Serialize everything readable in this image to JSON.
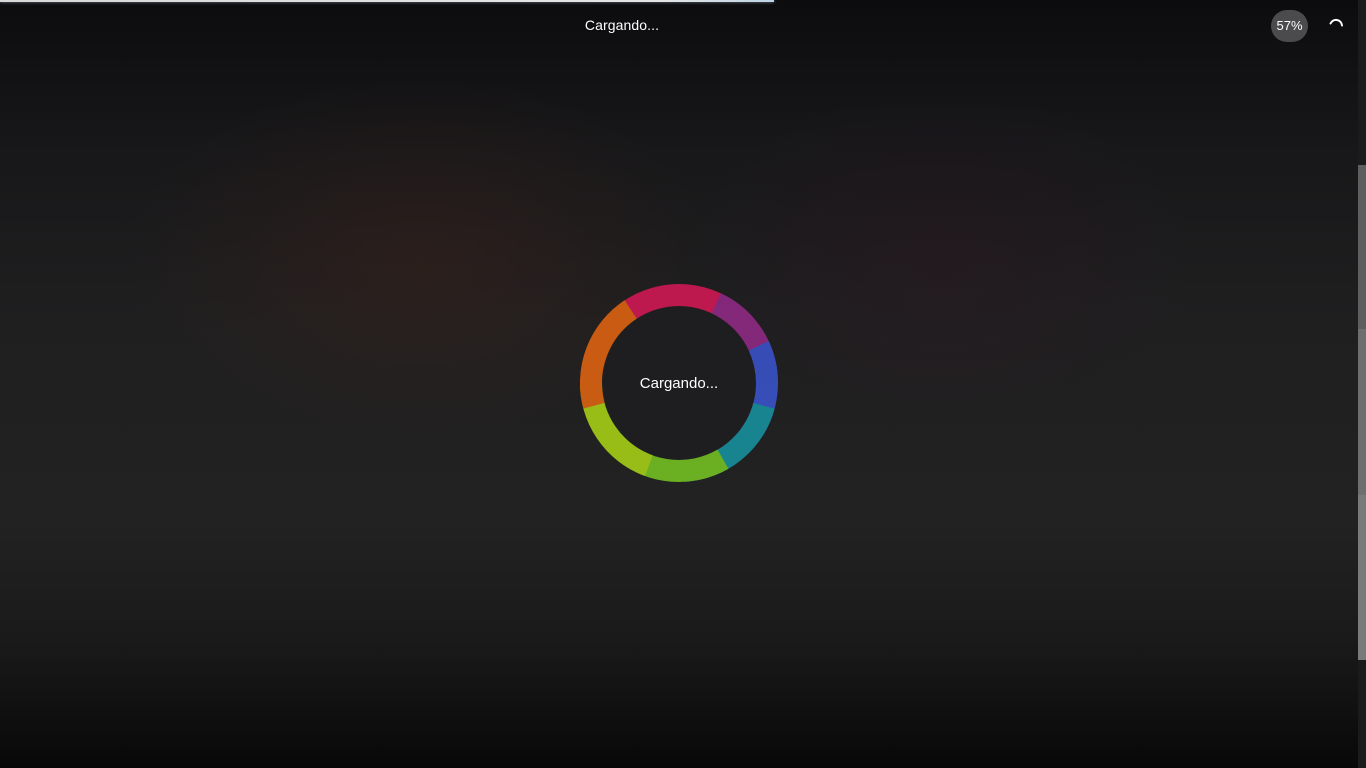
{
  "header": {
    "title": "Cargando...",
    "percent": "57%",
    "progress_fraction": 0.57
  },
  "loader": {
    "label": "Cargando..."
  },
  "icons": {
    "spinner": "spinner-icon"
  },
  "colors": {
    "ring_red": "#e0185a",
    "ring_orange": "#ee6a10",
    "ring_yellow_green": "#b3e016",
    "ring_green": "#7ccf22",
    "ring_teal": "#179aa8",
    "ring_blue": "#3d57d8",
    "ring_purple": "#9a2a8e"
  }
}
